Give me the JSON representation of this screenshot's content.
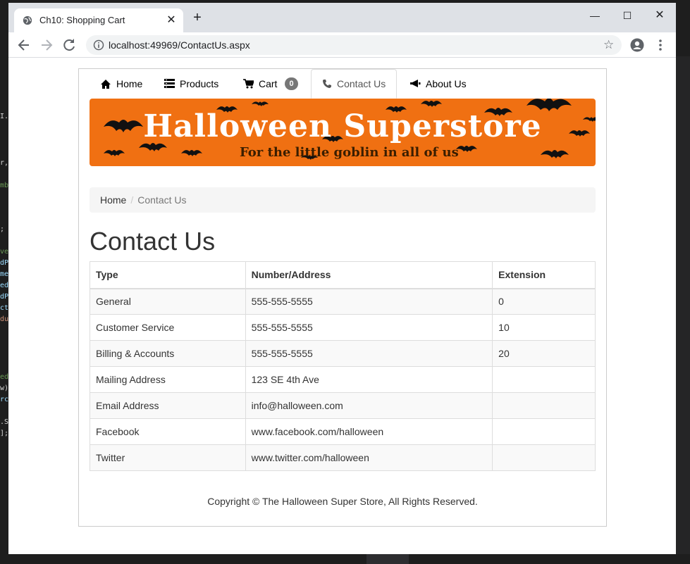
{
  "browser": {
    "tab_title": "Ch10: Shopping Cart",
    "tab_close": "✕",
    "new_tab": "+",
    "url": "localhost:49969/ContactUs.aspx",
    "minimize": "—",
    "maximize": "☐",
    "close": "✕",
    "bookmark_star": "☆"
  },
  "nav": {
    "items": [
      {
        "label": "Home",
        "icon": "home-icon"
      },
      {
        "label": "Products",
        "icon": "list-icon"
      },
      {
        "label": "Cart",
        "icon": "cart-icon",
        "badge": "0"
      },
      {
        "label": "Contact Us",
        "icon": "phone-icon",
        "active": true
      },
      {
        "label": "About Us",
        "icon": "megaphone-icon"
      }
    ]
  },
  "banner": {
    "title": "Halloween Superstore",
    "subtitle": "For the little goblin in all of us"
  },
  "breadcrumb": {
    "home": "Home",
    "separator": "/",
    "current": "Contact Us"
  },
  "page": {
    "title": "Contact Us"
  },
  "table": {
    "headers": [
      "Type",
      "Number/Address",
      "Extension"
    ],
    "rows": [
      [
        "General",
        "555-555-5555",
        "0"
      ],
      [
        "Customer Service",
        "555-555-5555",
        "10"
      ],
      [
        "Billing & Accounts",
        "555-555-5555",
        "20"
      ],
      [
        "Mailing Address",
        "123 SE 4th Ave",
        ""
      ],
      [
        "Email Address",
        "info@halloween.com",
        ""
      ],
      [
        "Facebook",
        "www.facebook.com/halloween",
        ""
      ],
      [
        "Twitter",
        "www.twitter.com/halloween",
        ""
      ]
    ]
  },
  "footer": {
    "copyright": "Copyright © The Halloween Super Store, All Rights Reserved."
  },
  "colors": {
    "banner": "#f07012",
    "badge": "#777777"
  }
}
